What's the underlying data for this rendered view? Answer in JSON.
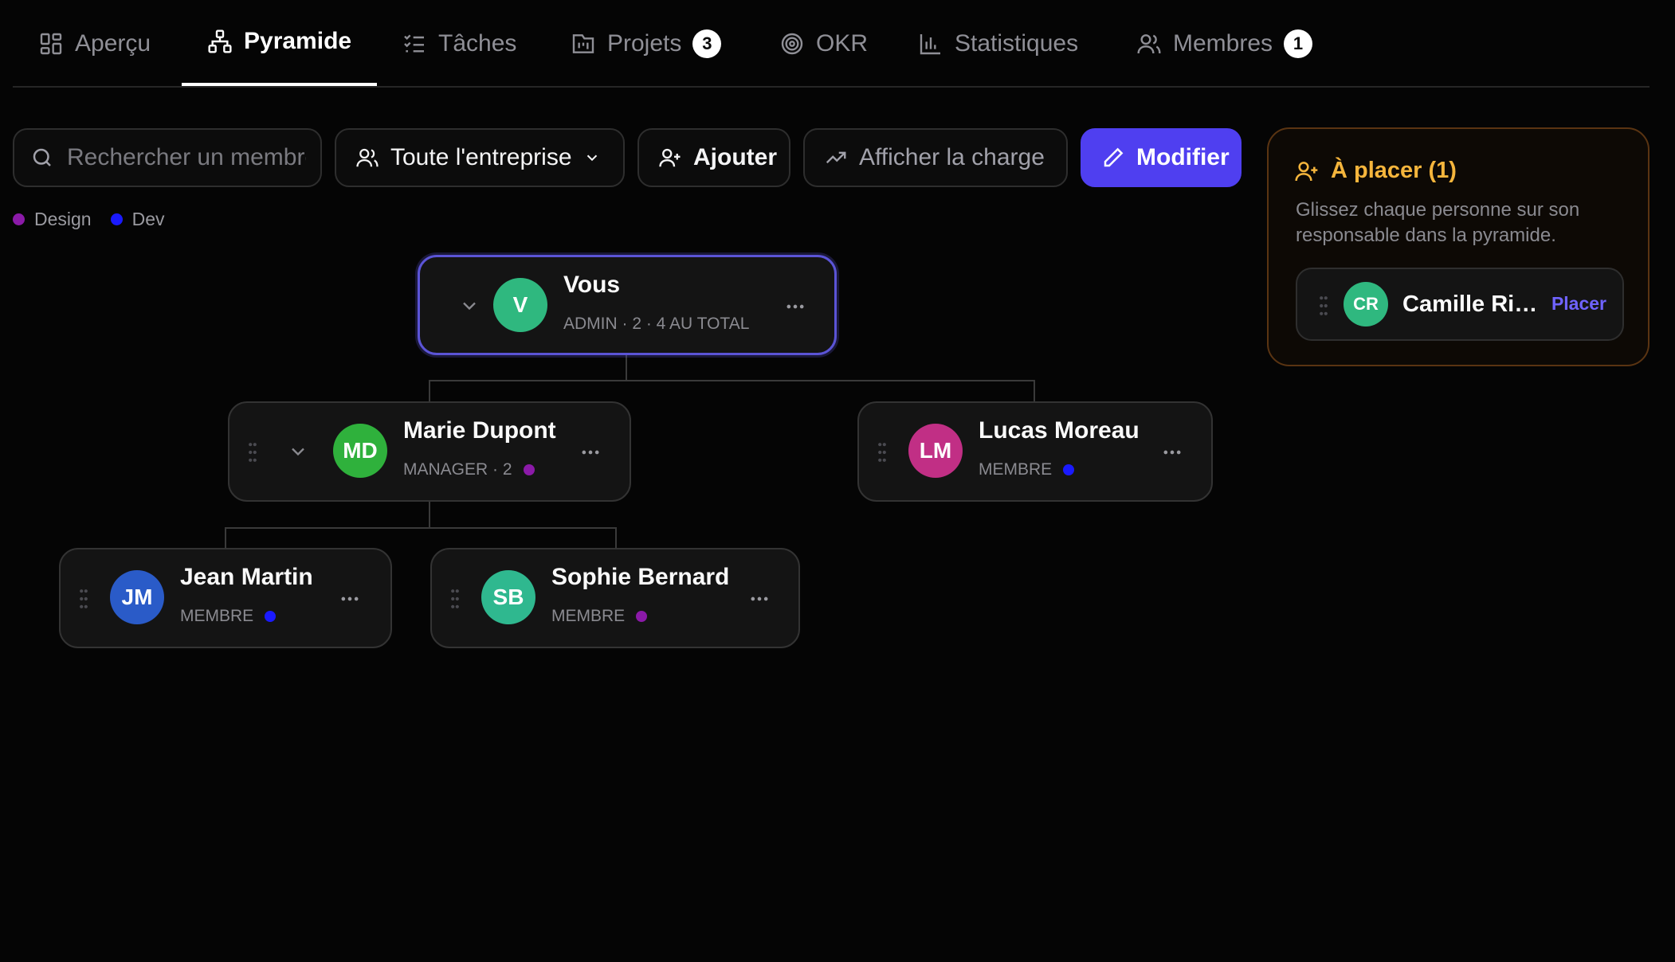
{
  "tabs": [
    {
      "label": "Aperçu",
      "icon": "layout-grid-icon",
      "active": false
    },
    {
      "label": "Pyramide",
      "icon": "org-chart-icon",
      "active": true
    },
    {
      "label": "Tâches",
      "icon": "task-list-icon",
      "active": false
    },
    {
      "label": "Projets",
      "icon": "kanban-icon",
      "active": false,
      "badge": "3"
    },
    {
      "label": "OKR",
      "icon": "target-icon",
      "active": false
    },
    {
      "label": "Statistiques",
      "icon": "bar-chart-icon",
      "active": false
    },
    {
      "label": "Membres",
      "icon": "users-icon",
      "active": false,
      "badge": "1"
    }
  ],
  "toolbar": {
    "search_placeholder": "Rechercher un membre",
    "scope_label": "Toute l'entreprise",
    "add_label": "Ajouter",
    "load_label": "Afficher la charge",
    "edit_label": "Modifier"
  },
  "legend": [
    {
      "label": "Design",
      "color": "#8b1aa8"
    },
    {
      "label": "Dev",
      "color": "#1a1aff"
    }
  ],
  "tree": {
    "root": {
      "initials": "V",
      "name": "Vous",
      "meta": "ADMIN · 2 · 4 AU TOTAL",
      "avatar_color": "#2fb87f"
    },
    "marie": {
      "initials": "MD",
      "name": "Marie Dupont",
      "meta": "MANAGER · 2",
      "avatar_color": "#2fb13c",
      "team_color": "#8b1aa8"
    },
    "lucas": {
      "initials": "LM",
      "name": "Lucas Moreau",
      "meta": "MEMBRE",
      "avatar_color": "#c12f85",
      "team_color": "#1a1aff"
    },
    "jean": {
      "initials": "JM",
      "name": "Jean Martin",
      "meta": "MEMBRE",
      "avatar_color": "#2a5bc8",
      "team_color": "#1a1aff"
    },
    "sophie": {
      "initials": "SB",
      "name": "Sophie Bernard",
      "meta": "MEMBRE",
      "avatar_color": "#2fb88f",
      "team_color": "#8b1aa8"
    }
  },
  "to_place": {
    "title": "À placer (1)",
    "description": "Glissez chaque personne sur son responsable dans la pyramide.",
    "people": [
      {
        "initials": "CR",
        "name": "Camille Rivière",
        "action": "Placer",
        "avatar_color": "#2fb87f"
      }
    ]
  },
  "colors": {
    "accent": "#4f3ff0",
    "warning": "#f5b53c",
    "background": "#050505"
  }
}
